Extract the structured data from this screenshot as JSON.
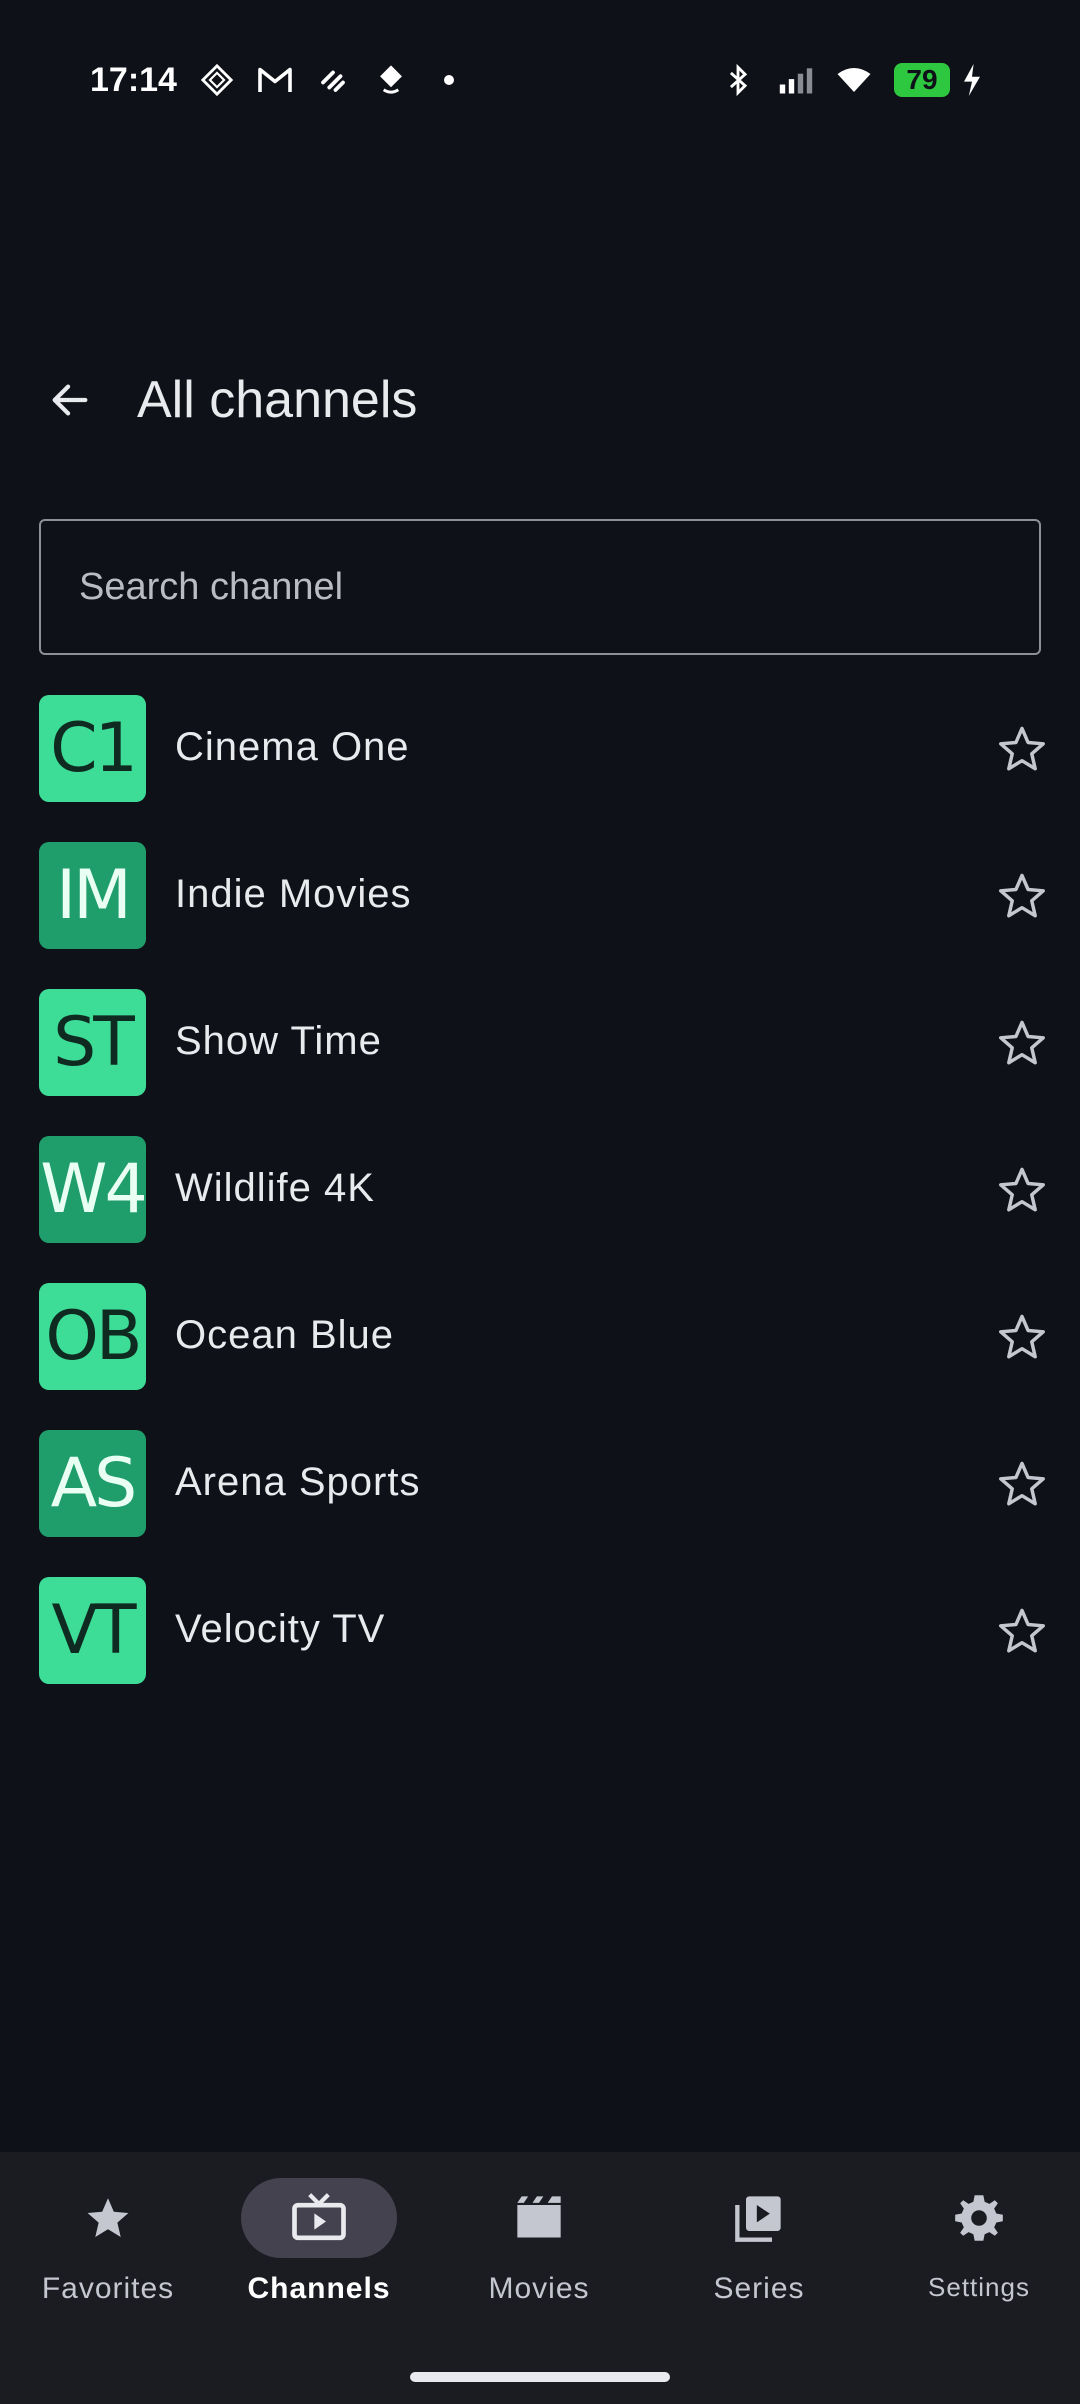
{
  "status_bar": {
    "time": "17:14",
    "battery": "79",
    "icons": [
      "notification-icon",
      "gmail-icon",
      "app-icon",
      "app-icon-2",
      "dot-icon",
      "bluetooth-icon",
      "signal-icon",
      "wifi-icon",
      "charging-icon"
    ]
  },
  "header": {
    "title": "All channels",
    "back_icon": "arrow-left-icon"
  },
  "search": {
    "placeholder": "Search channel",
    "value": ""
  },
  "channels": [
    {
      "abbr": "C1",
      "name": "Cinema One",
      "style": "light"
    },
    {
      "abbr": "IM",
      "name": "Indie Movies",
      "style": "dark"
    },
    {
      "abbr": "ST",
      "name": "Show Time",
      "style": "light"
    },
    {
      "abbr": "W4",
      "name": "Wildlife 4K",
      "style": "dark"
    },
    {
      "abbr": "OB",
      "name": "Ocean Blue",
      "style": "light"
    },
    {
      "abbr": "AS",
      "name": "Arena Sports",
      "style": "dark"
    },
    {
      "abbr": "VT",
      "name": "Velocity TV",
      "style": "light"
    }
  ],
  "bottom_nav": {
    "items": [
      {
        "label": "Favorites",
        "icon": "star-icon",
        "active": false
      },
      {
        "label": "Channels",
        "icon": "tv-icon",
        "active": true
      },
      {
        "label": "Movies",
        "icon": "clapperboard-icon",
        "active": false
      },
      {
        "label": "Series",
        "icon": "play-library-icon",
        "active": false
      },
      {
        "label": "Settings",
        "icon": "gear-icon",
        "active": false
      }
    ]
  },
  "colors": {
    "background": "#0e1117",
    "logo_light": "#3ddc97",
    "logo_dark": "#1f9e6b",
    "nav_background": "#1b1c22",
    "active_pill": "#45424f"
  }
}
